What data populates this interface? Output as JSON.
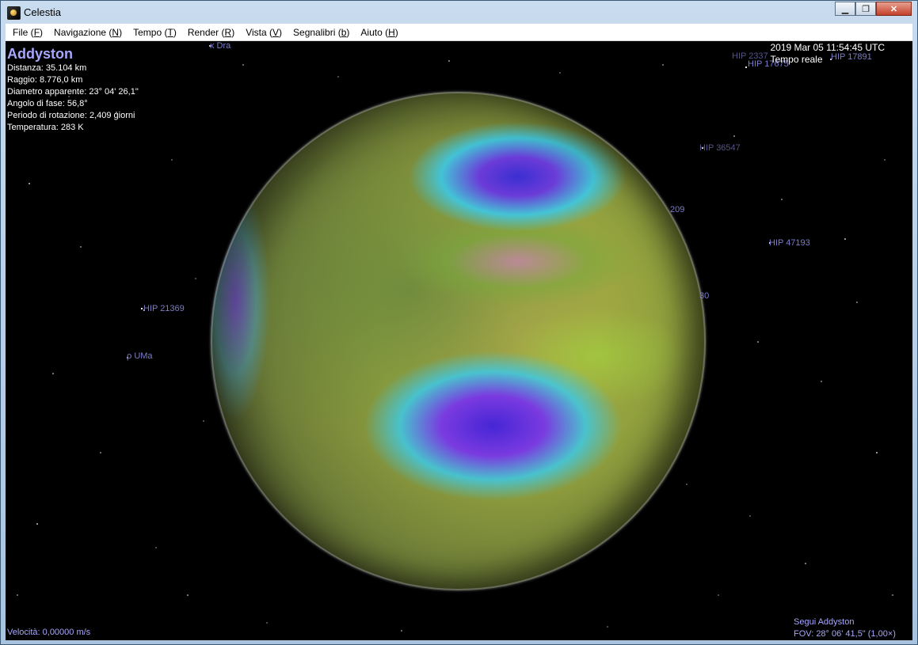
{
  "window": {
    "title": "Celestia"
  },
  "menu": [
    {
      "label": "File",
      "key": "F"
    },
    {
      "label": "Navigazione",
      "key": "N"
    },
    {
      "label": "Tempo",
      "key": "T"
    },
    {
      "label": "Render",
      "key": "R"
    },
    {
      "label": "Vista",
      "key": "V"
    },
    {
      "label": "Segnalibri",
      "key": "b"
    },
    {
      "label": "Aiuto",
      "key": "H"
    }
  ],
  "selection": {
    "name": "Addyston",
    "distance": "Distanza: 35.104 km",
    "radius": "Raggio: 8.776,0 km",
    "apparent_diameter": "Diametro apparente: 23° 04' 26,1\"",
    "phase_angle": "Angolo di fase: 56,8°",
    "rotation_period": "Periodo di rotazione: 2,409 giorni",
    "temperature": "Temperatura: 283 K"
  },
  "time": {
    "datetime": "2019 Mar 05 11:54:45 UTC",
    "mode": "Tempo reale"
  },
  "star_labels": [
    "κ Dra",
    "HIP 2337",
    "HIP 17675",
    "HIP 17891",
    "HIP 36547",
    "HIP 47193",
    "HIP 21369",
    "ρ UMa",
    "209",
    "30"
  ],
  "status": {
    "velocity": "Velocità: 0,00000 m/s",
    "follow": "Segui Addyston",
    "fov": "FOV: 28° 06' 41,5\" (1,00×)"
  }
}
